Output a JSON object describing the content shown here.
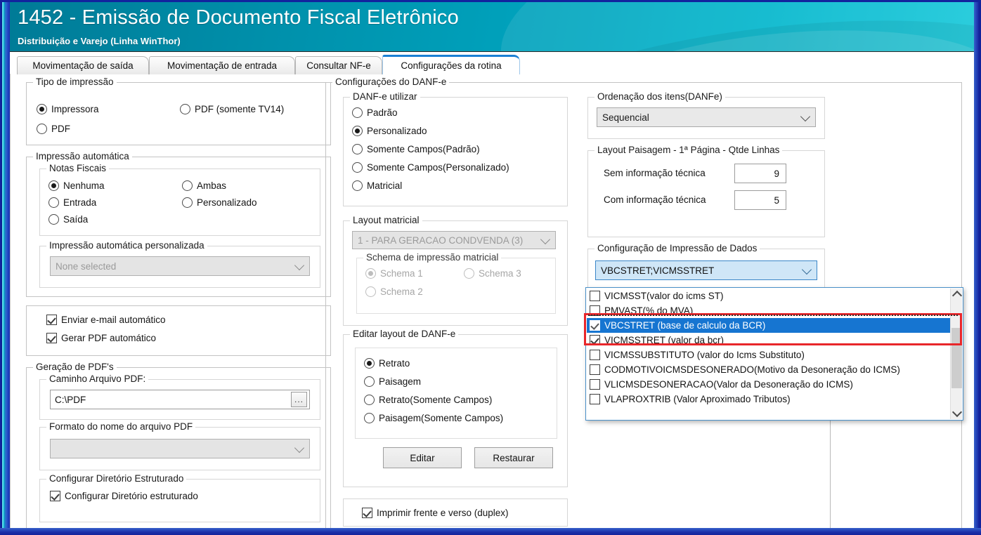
{
  "window": {
    "title": "1452 - Emissão de Documento Fiscal Eletrônico",
    "subtitle": "Distribuição e Varejo (Linha WinThor)"
  },
  "tabs": [
    {
      "label": "Movimentação de saída",
      "active": false
    },
    {
      "label": "Movimentação de entrada",
      "active": false
    },
    {
      "label": "Consultar NF-e",
      "active": false
    },
    {
      "label": "Configurações da rotina",
      "active": true
    }
  ],
  "left_column": {
    "tipo_impressao": {
      "title": "Tipo de impressão",
      "options": [
        {
          "label": "Impressora",
          "selected": true
        },
        {
          "label": "PDF (somente TV14)",
          "selected": false
        },
        {
          "label": "PDF",
          "selected": false
        }
      ]
    },
    "impressao_automatica": {
      "title": "Impressão automática",
      "notas_fiscais": {
        "title": "Notas Fiscais",
        "options": [
          {
            "label": "Nenhuma",
            "selected": true
          },
          {
            "label": "Ambas",
            "selected": false
          },
          {
            "label": "Entrada",
            "selected": false
          },
          {
            "label": "Personalizado",
            "selected": false
          },
          {
            "label": "Saída",
            "selected": false
          }
        ]
      },
      "personalizada": {
        "title": "Impressão automática personalizada",
        "combo_value": "None selected",
        "enabled": false
      }
    },
    "checks": [
      {
        "label": "Enviar e-mail automático",
        "checked": true
      },
      {
        "label": "Gerar PDF automático",
        "checked": true
      }
    ],
    "geracao_pdf": {
      "title": "Geração de PDF's",
      "caminho": {
        "title": "Caminho Arquivo PDF:",
        "value": "C:\\PDF",
        "browse_label": "..."
      },
      "formato": {
        "title": "Formato do nome do arquivo PDF",
        "combo_value": ""
      },
      "diretorio": {
        "title": "Configurar Diretório Estruturado",
        "check_label": "Configurar Diretório estruturado",
        "checked": true
      }
    }
  },
  "middle_column": {
    "title": "Configurações do DANF-e",
    "danfe_utilizar": {
      "title": "DANF-e utilizar",
      "options": [
        {
          "label": "Padrão",
          "selected": false
        },
        {
          "label": "Personalizado",
          "selected": true
        },
        {
          "label": "Somente Campos(Padrão)",
          "selected": false
        },
        {
          "label": "Somente Campos(Personalizado)",
          "selected": false
        },
        {
          "label": "Matricial",
          "selected": false
        }
      ]
    },
    "layout_matricial": {
      "title": "Layout matricial",
      "combo_value": "1 - PARA GERACAO CONDVENDA (3)",
      "enabled": false,
      "schema": {
        "title": "Schema de impressão matricial",
        "options": [
          {
            "label": "Schema 1",
            "selected": true
          },
          {
            "label": "Schema 3",
            "selected": false
          },
          {
            "label": "Schema 2",
            "selected": false
          }
        ]
      }
    },
    "editar_layout": {
      "title": "Editar layout de DANF-e",
      "options": [
        {
          "label": "Retrato",
          "selected": true
        },
        {
          "label": "Paisagem",
          "selected": false
        },
        {
          "label": "Retrato(Somente Campos)",
          "selected": false
        },
        {
          "label": "Paisagem(Somente Campos)",
          "selected": false
        }
      ],
      "buttons": {
        "edit": "Editar",
        "restore": "Restaurar"
      }
    },
    "duplex": {
      "label": "Imprimir frente e verso (duplex)",
      "checked": true
    }
  },
  "right_column": {
    "ordenacao": {
      "title": "Ordenação dos itens(DANFe)",
      "combo_value": "Sequencial"
    },
    "layout_paisagem": {
      "title": "Layout Paisagem - 1ª Página - Qtde Linhas",
      "rows": [
        {
          "label": "Sem informação técnica",
          "value": "9"
        },
        {
          "label": "Com informação técnica",
          "value": "5"
        }
      ]
    },
    "config_impressao_dados": {
      "title": "Configuração de Impressão de Dados",
      "combo_value": "VBCSTRET;VICMSSTRET",
      "dropdown_open": true,
      "items": [
        {
          "label": "VICMSST(valor do icms ST)",
          "checked": false,
          "selected": false,
          "highlighted": false
        },
        {
          "label": "PMVAST(% do MVA)",
          "checked": false,
          "selected": false,
          "highlighted": false
        },
        {
          "label": "VBCSTRET (base de calculo da BCR)",
          "checked": true,
          "selected": true,
          "highlighted": true
        },
        {
          "label": "VICMSSTRET (valor da bcr)",
          "checked": true,
          "selected": false,
          "highlighted": true
        },
        {
          "label": "VICMSSUBSTITUTO (valor do Icms Substituto)",
          "checked": false,
          "selected": false,
          "highlighted": false
        },
        {
          "label": "CODMOTIVOICMSDESONERADO(Motivo da Desoneração do ICMS)",
          "checked": false,
          "selected": false,
          "highlighted": false
        },
        {
          "label": "VLICMSDESONERACAO(Valor da Desoneração do ICMS)",
          "checked": false,
          "selected": false,
          "highlighted": false
        },
        {
          "label": "VLAPROXTRIB (Valor Aproximado Tributos)",
          "checked": false,
          "selected": false,
          "highlighted": false
        }
      ]
    }
  },
  "colors": {
    "header_teal": "#00a3bd",
    "accent_blue": "#1675d1",
    "annotation_red": "#e8262a",
    "window_border_blue": "#13229b"
  }
}
